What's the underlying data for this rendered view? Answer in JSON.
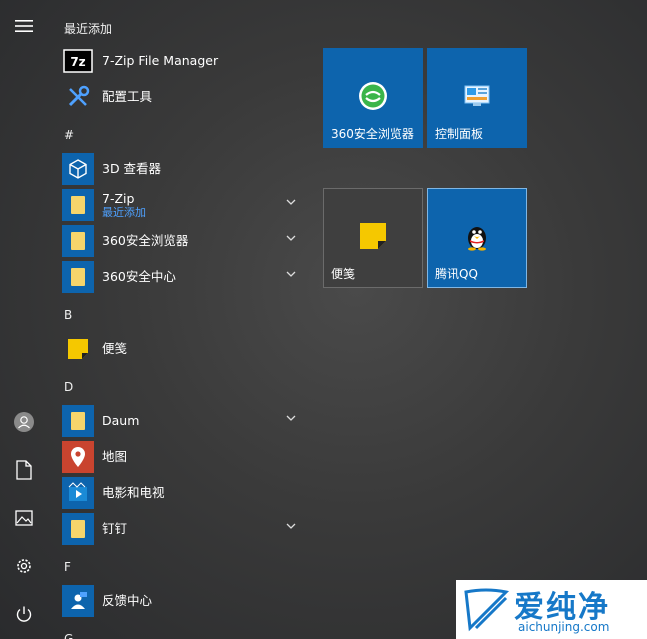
{
  "sections": {
    "recent": "最近添加",
    "hash": "#",
    "b": "B",
    "d": "D",
    "f": "F",
    "g": "G"
  },
  "apps": {
    "zip_manager": "7-Zip File Manager",
    "config_tool": "配置工具",
    "viewer3d": "3D 查看器",
    "zip": "7-Zip",
    "zip_sub": "最近添加",
    "browser360": "360安全浏览器",
    "center360": "360安全中心",
    "sticky": "便笺",
    "daum": "Daum",
    "maps": "地图",
    "movies": "电影和电视",
    "dingtalk": "钉钉",
    "feedback": "反馈中心"
  },
  "tiles": {
    "browser360": "360安全浏览器",
    "control_panel": "控制面板",
    "sticky": "便笺",
    "qq": "腾讯QQ"
  },
  "watermark": {
    "title": "爱纯净",
    "url": "aichunjing.com"
  },
  "icons": [
    "menu-icon",
    "user-icon",
    "document-icon",
    "pictures-icon",
    "settings-icon",
    "power-icon",
    "folder-icon",
    "chevron-down-icon"
  ],
  "colors": {
    "tile_blue": "#0d64ad",
    "folder_yellow": "#f6d56b",
    "accent_link": "#4ea1ff",
    "sticky_yellow": "#f5c800"
  }
}
